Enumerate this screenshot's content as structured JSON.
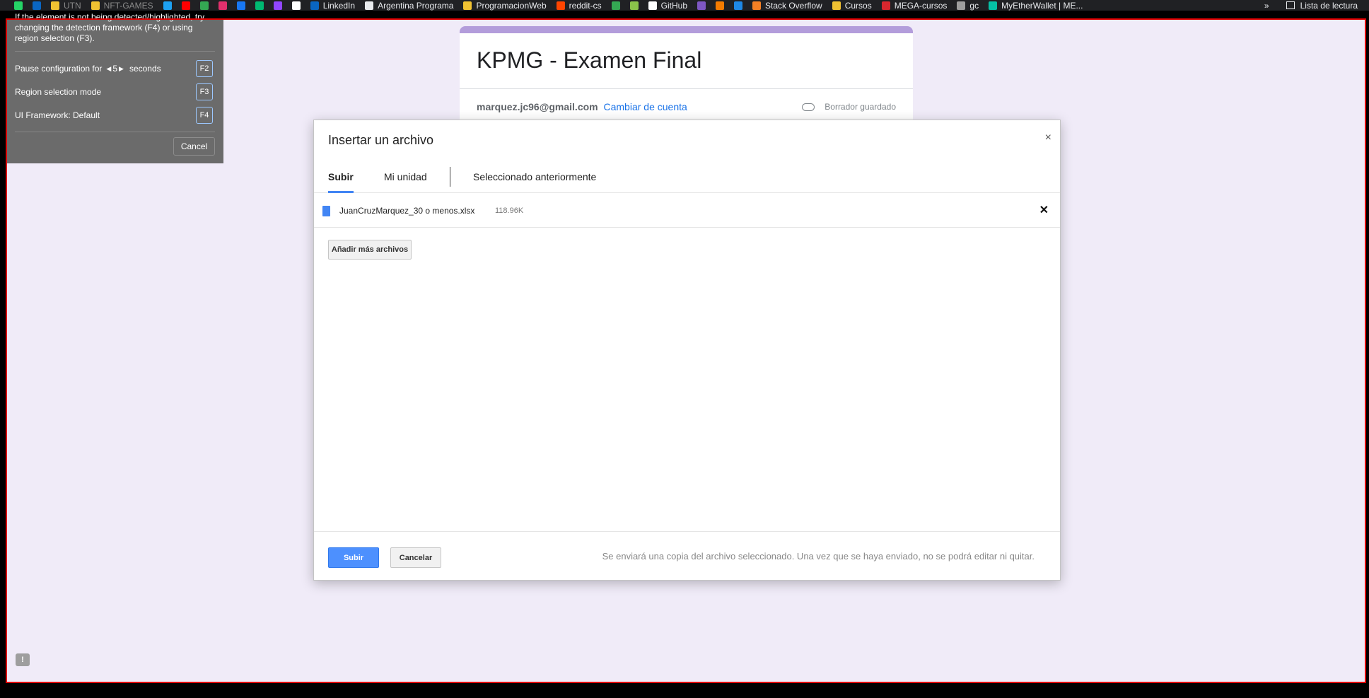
{
  "bookmarks": {
    "items": [
      {
        "label": "",
        "color": "#25d366",
        "dim": false
      },
      {
        "label": "",
        "color": "#0a66c2",
        "dim": false
      },
      {
        "label": "UTN",
        "color": "#f1c232",
        "dim": true
      },
      {
        "label": "NFT-GAMES",
        "color": "#f1c232",
        "dim": true
      },
      {
        "label": "",
        "color": "#1da1f2",
        "dim": false
      },
      {
        "label": "",
        "color": "#ff0000",
        "dim": false
      },
      {
        "label": "",
        "color": "#34a853",
        "dim": false
      },
      {
        "label": "",
        "color": "#e1306c",
        "dim": false
      },
      {
        "label": "",
        "color": "#1877f2",
        "dim": false
      },
      {
        "label": "",
        "color": "#00b871",
        "dim": false
      },
      {
        "label": "",
        "color": "#9146ff",
        "dim": false
      },
      {
        "label": "",
        "color": "#ffffff",
        "dim": false
      },
      {
        "label": "LinkedIn",
        "color": "#0a66c2",
        "dim": false
      },
      {
        "label": "Argentina Programa",
        "color": "#e8eaed",
        "dim": false
      },
      {
        "label": "ProgramacionWeb",
        "color": "#f1c232",
        "dim": false
      },
      {
        "label": "reddit-cs",
        "color": "#ff4500",
        "dim": false
      },
      {
        "label": "",
        "color": "#34a853",
        "dim": false
      },
      {
        "label": "",
        "color": "#8bc34a",
        "dim": false
      },
      {
        "label": "GitHub",
        "color": "#ffffff",
        "dim": false
      },
      {
        "label": "",
        "color": "#7e57c2",
        "dim": false
      },
      {
        "label": "",
        "color": "#f57c00",
        "dim": false
      },
      {
        "label": "",
        "color": "#1e88e5",
        "dim": false
      },
      {
        "label": "Stack Overflow",
        "color": "#f48024",
        "dim": false
      },
      {
        "label": "Cursos",
        "color": "#f1c232",
        "dim": false
      },
      {
        "label": "MEGA-cursos",
        "color": "#d9272e",
        "dim": false
      },
      {
        "label": "gc",
        "color": "#9e9e9e",
        "dim": false
      },
      {
        "label": "MyEtherWallet | ME...",
        "color": "#05c0a5",
        "dim": false
      }
    ],
    "more": "»",
    "reading_list": "Lista de lectura"
  },
  "tool": {
    "help_text": "If the element is not being detected/highlighted, try changing the detection framework (F4) or using region selection (F3).",
    "pause_prefix": "Pause configuration for",
    "pause_value": "5",
    "pause_suffix": "seconds",
    "pause_key": "F2",
    "region_label": "Region selection mode",
    "region_key": "F3",
    "framework_label": "UI Framework: Default",
    "framework_key": "F4",
    "cancel_label": "Cancel"
  },
  "form": {
    "title": "KPMG - Examen Final",
    "email": "marquez.jc96@gmail.com",
    "switch_account": "Cambiar de cuenta",
    "draft_status": "Borrador guardado"
  },
  "dialog": {
    "title": "Insertar un archivo",
    "close": "×",
    "tabs": [
      {
        "label": "Subir",
        "active": true
      },
      {
        "label": "Mi unidad",
        "active": false
      },
      {
        "label": "Seleccionado anteriormente",
        "active": false
      }
    ],
    "file": {
      "name": "JuanCruzMarquez_30 o menos.xlsx",
      "size": "118.96K",
      "remove": "✕"
    },
    "add_more": "Añadir más archivos",
    "upload": "Subir",
    "cancel": "Cancelar",
    "note": "Se enviará una copia del archivo seleccionado. Una vez que se haya enviado, no se podrá editar ni quitar."
  },
  "feedback_icon": "!"
}
